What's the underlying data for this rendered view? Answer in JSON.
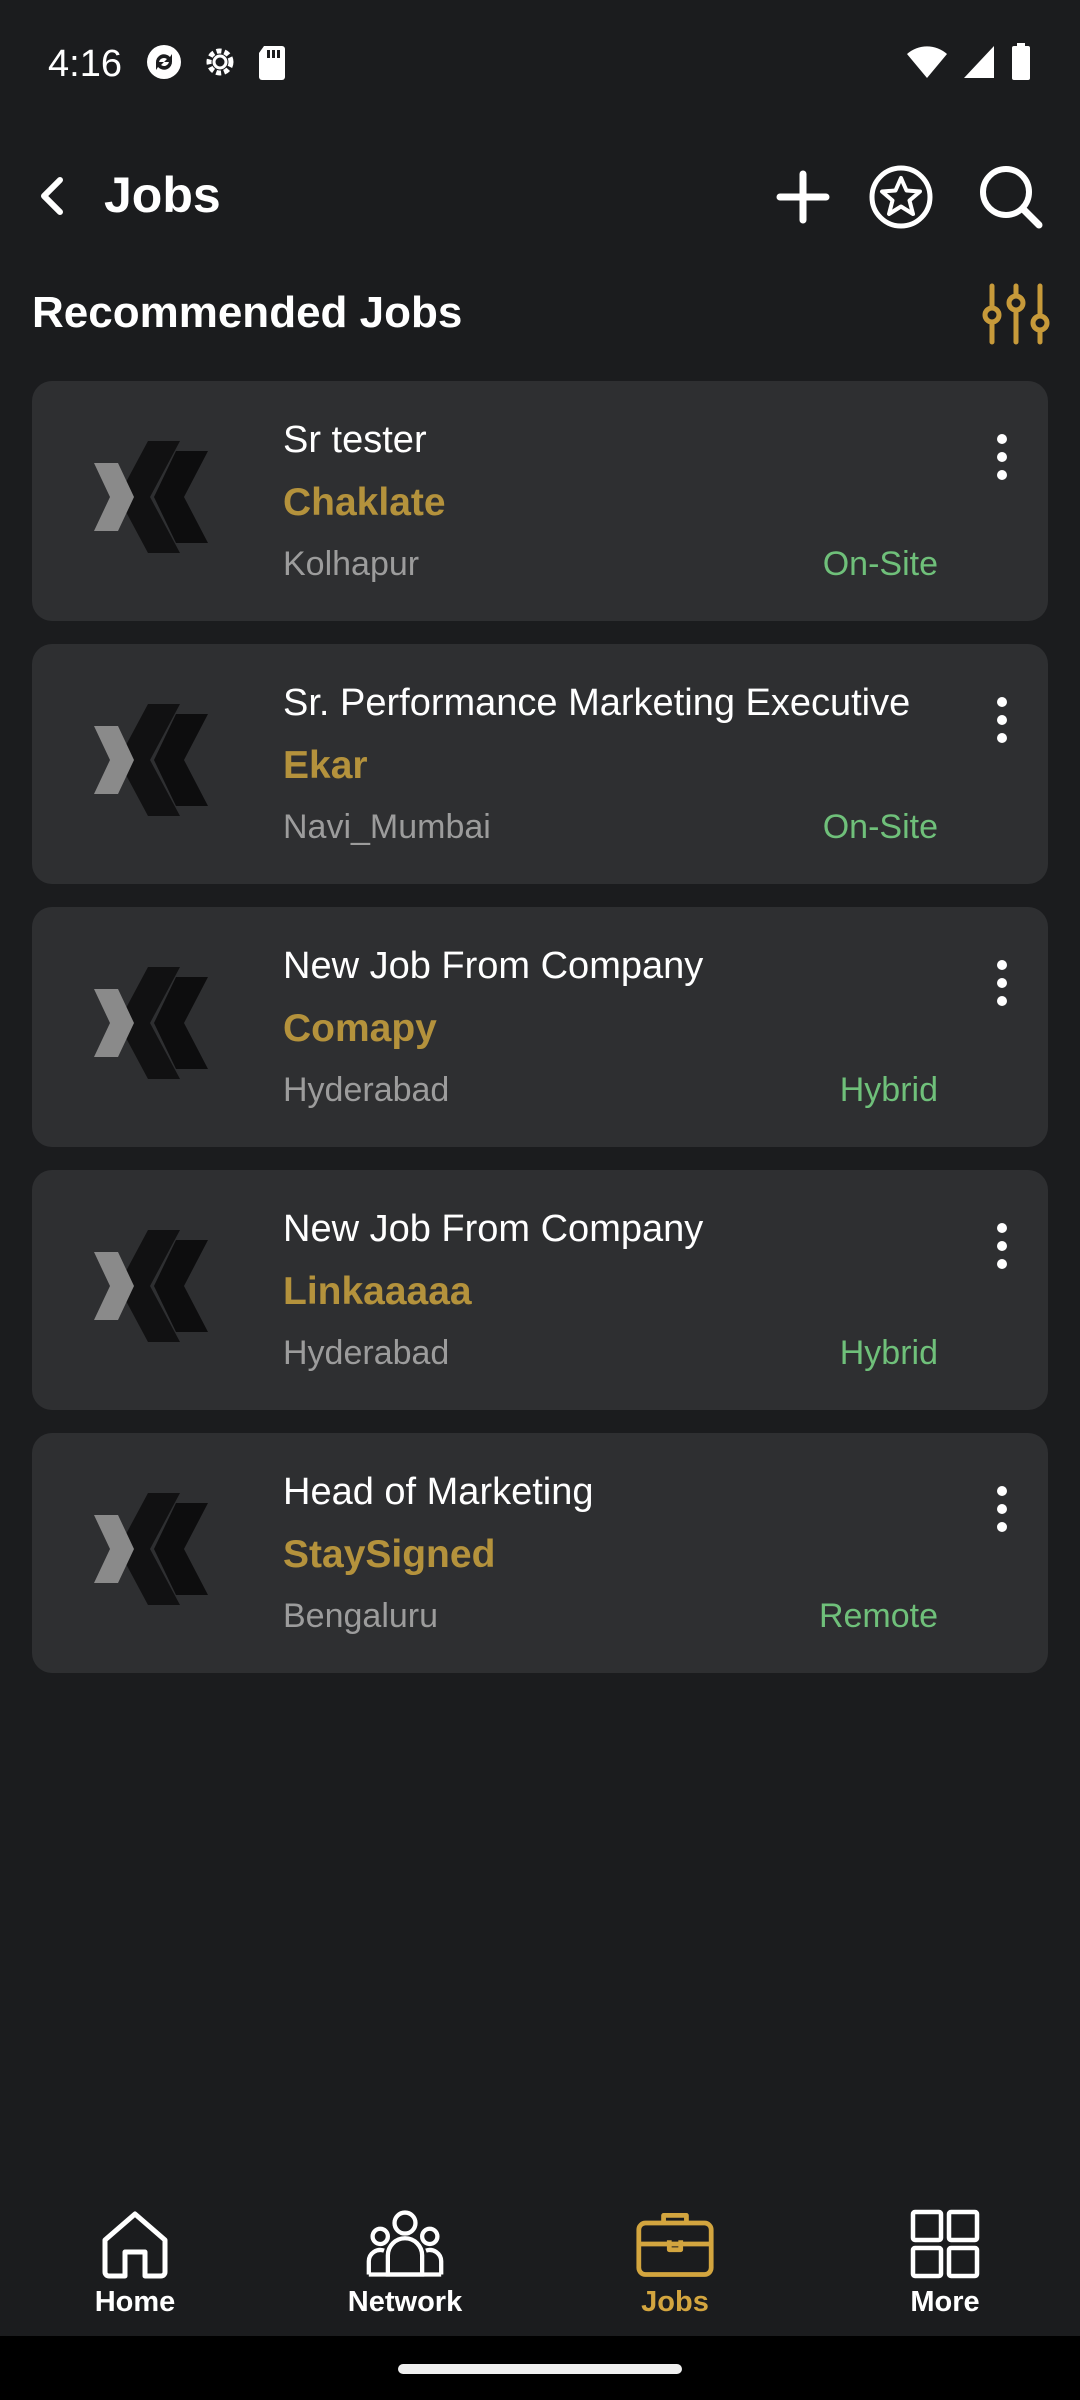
{
  "status_bar": {
    "time": "4:16",
    "left_icons": [
      "sync-icon",
      "settings-icon",
      "sd-card-icon"
    ],
    "right_icons": [
      "wifi-icon",
      "signal-icon",
      "battery-icon"
    ]
  },
  "app_bar": {
    "title": "Jobs",
    "actions": [
      "add-icon",
      "star-icon",
      "search-icon"
    ]
  },
  "section": {
    "title": "Recommended Jobs"
  },
  "jobs": [
    {
      "title": "Sr tester",
      "company": "Chaklate",
      "location": "Kolhapur",
      "work_type": "On-Site"
    },
    {
      "title": "Sr. Performance Marketing Executive",
      "company": "Ekar",
      "location": "Navi_Mumbai",
      "work_type": "On-Site"
    },
    {
      "title": "New Job From Company",
      "company": "Comapy",
      "location": "Hyderabad",
      "work_type": "Hybrid"
    },
    {
      "title": "New Job From Company",
      "company": "Linkaaaaa",
      "location": "Hyderabad",
      "work_type": "Hybrid"
    },
    {
      "title": "Head of Marketing",
      "company": "StaySigned",
      "location": "Bengaluru",
      "work_type": "Remote"
    }
  ],
  "bottom_nav": {
    "items": [
      {
        "label": "Home",
        "icon": "home-icon"
      },
      {
        "label": "Network",
        "icon": "network-icon"
      },
      {
        "label": "Jobs",
        "icon": "briefcase-icon",
        "active": true
      },
      {
        "label": "More",
        "icon": "grid-icon"
      }
    ]
  },
  "colors": {
    "background": "#1b1c1e",
    "card": "#2e2f31",
    "accent_gold": "#b4923c",
    "active_nav": "#d3a53f",
    "work_type_green": "#6fc07a",
    "muted_text": "#9c9c9c"
  }
}
